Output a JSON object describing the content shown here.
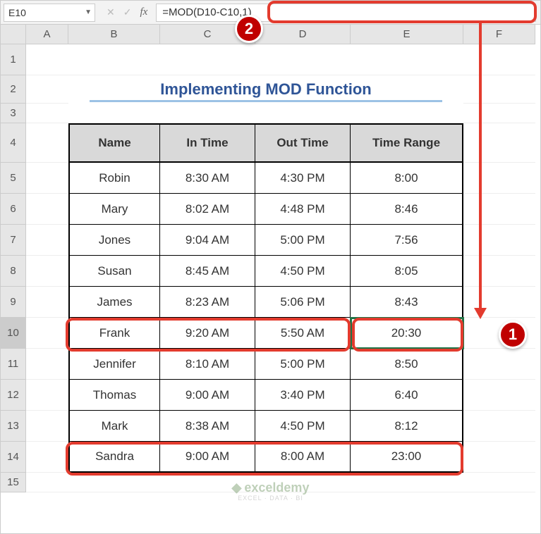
{
  "nameBox": "E10",
  "formula": "=MOD(D10-C10,1)",
  "columns": [
    "",
    "A",
    "B",
    "C",
    "D",
    "E",
    "F"
  ],
  "title": "Implementing MOD Function",
  "headers": [
    "Name",
    "In Time",
    "Out Time",
    "Time Range"
  ],
  "rows": [
    {
      "name": "Robin",
      "in": "8:30 AM",
      "out": "4:30 PM",
      "range": "8:00"
    },
    {
      "name": "Mary",
      "in": "8:02 AM",
      "out": "4:48 PM",
      "range": "8:46"
    },
    {
      "name": "Jones",
      "in": "9:04 AM",
      "out": "5:00 PM",
      "range": "7:56"
    },
    {
      "name": "Susan",
      "in": "8:45 AM",
      "out": "4:50 PM",
      "range": "8:05"
    },
    {
      "name": "James",
      "in": "8:23 AM",
      "out": "5:06 PM",
      "range": "8:43"
    },
    {
      "name": "Frank",
      "in": "9:20 AM",
      "out": "5:50 AM",
      "range": "20:30"
    },
    {
      "name": "Jennifer",
      "in": "8:10 AM",
      "out": "5:00 PM",
      "range": "8:50"
    },
    {
      "name": "Thomas",
      "in": "9:00 AM",
      "out": "3:40 PM",
      "range": "6:40"
    },
    {
      "name": "Mark",
      "in": "8:38 AM",
      "out": "4:50 PM",
      "range": "8:12"
    },
    {
      "name": "Sandra",
      "in": "9:00 AM",
      "out": "8:00 AM",
      "range": "23:00"
    }
  ],
  "rowNumbers": [
    "1",
    "2",
    "3",
    "4",
    "5",
    "6",
    "7",
    "8",
    "9",
    "10",
    "11",
    "12",
    "13",
    "14",
    "15"
  ],
  "badges": {
    "one": "1",
    "two": "2"
  },
  "watermark": {
    "top": "exceldemy",
    "bot": "EXCEL · DATA · BI"
  },
  "chart_data": {
    "type": "table",
    "title": "Implementing MOD Function",
    "columns": [
      "Name",
      "In Time",
      "Out Time",
      "Time Range"
    ],
    "data": [
      [
        "Robin",
        "8:30 AM",
        "4:30 PM",
        "8:00"
      ],
      [
        "Mary",
        "8:02 AM",
        "4:48 PM",
        "8:46"
      ],
      [
        "Jones",
        "9:04 AM",
        "5:00 PM",
        "7:56"
      ],
      [
        "Susan",
        "8:45 AM",
        "4:50 PM",
        "8:05"
      ],
      [
        "James",
        "8:23 AM",
        "5:06 PM",
        "8:43"
      ],
      [
        "Frank",
        "9:20 AM",
        "5:50 AM",
        "20:30"
      ],
      [
        "Jennifer",
        "8:10 AM",
        "5:00 PM",
        "8:50"
      ],
      [
        "Thomas",
        "9:00 AM",
        "3:40 PM",
        "6:40"
      ],
      [
        "Mark",
        "8:38 AM",
        "4:50 PM",
        "8:12"
      ],
      [
        "Sandra",
        "9:00 AM",
        "8:00 AM",
        "23:00"
      ]
    ],
    "formula_cell": "E10",
    "formula": "=MOD(D10-C10,1)"
  }
}
